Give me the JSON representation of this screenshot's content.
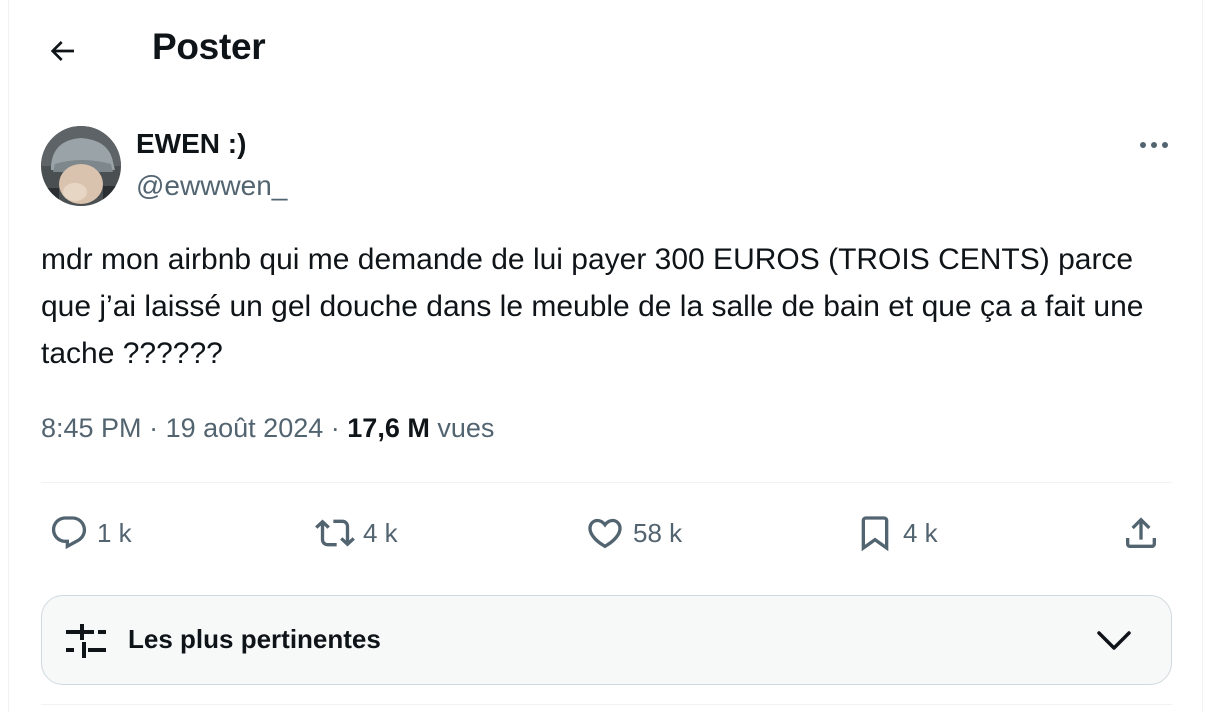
{
  "header": {
    "title": "Poster",
    "back_icon": "arrow-left-icon"
  },
  "tweet": {
    "display_name": "EWEN :)",
    "handle": "@ewwwen_",
    "text": "mdr mon airbnb qui me demande de lui payer 300 EUROS (TROIS CENTS) parce que j’ai laissé un gel douche dans le meuble de la salle de bain et que ça a fait une tache ??????",
    "time": "8:45 PM",
    "date": "19 août 2024",
    "views_count": "17,6 M",
    "views_label": "vues",
    "separator": "·"
  },
  "actions": {
    "replies": "1 k",
    "reposts": "4 k",
    "likes": "58 k",
    "bookmarks": "4 k"
  },
  "sort": {
    "label": "Les plus pertinentes"
  },
  "colors": {
    "text_primary": "#0f1419",
    "text_secondary": "#536471",
    "border": "#cfd9de",
    "sort_bg": "#f7f9f9"
  }
}
